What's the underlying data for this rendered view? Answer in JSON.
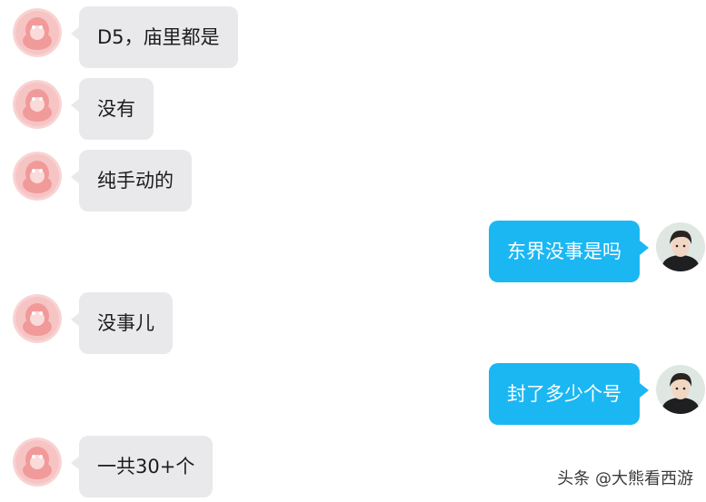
{
  "messages": [
    {
      "side": "left",
      "text": "D5，庙里都是",
      "avatar": "pink-qq-penguin-icon"
    },
    {
      "side": "left",
      "text": "没有",
      "avatar": "pink-qq-penguin-icon"
    },
    {
      "side": "left",
      "text": "纯手动的",
      "avatar": "pink-qq-penguin-icon"
    },
    {
      "side": "right",
      "text": "东界没事是吗",
      "avatar": "user-photo-icon"
    },
    {
      "side": "left",
      "text": "没事儿",
      "avatar": "pink-qq-penguin-icon"
    },
    {
      "side": "right",
      "text": "封了多少个号",
      "avatar": "user-photo-icon"
    },
    {
      "side": "left",
      "text": "一共30+个",
      "avatar": "pink-qq-penguin-icon"
    }
  ],
  "colors": {
    "incoming_bubble": "#e9e9eb",
    "outgoing_bubble": "#1bb7f3",
    "incoming_text": "#1c1c1c",
    "outgoing_text": "#ffffff",
    "avatar_pink": "#f4a5a5"
  },
  "watermark": "头条 @大熊看西游"
}
